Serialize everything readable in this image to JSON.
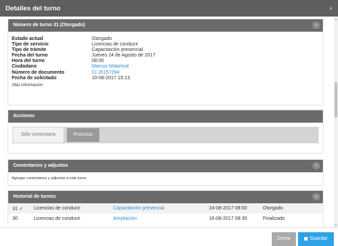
{
  "modal": {
    "title": "Detalles del turno",
    "close_icon": "close-icon"
  },
  "turno_panel": {
    "title": "Número de turno 31 (Otorgado)",
    "fields": [
      {
        "label": "Estado actual",
        "value": "Otorgado",
        "link": false
      },
      {
        "label": "Tipo de servicio",
        "value": "Licencias de conducir",
        "link": false
      },
      {
        "label": "Tipo de trámite",
        "value": "Capacitación presencial",
        "link": false
      },
      {
        "label": "Fecha del turno",
        "value": "Jueves 24 de Agosto de 2017",
        "link": false
      },
      {
        "label": "Hora del turno",
        "value": "08:00",
        "link": false
      },
      {
        "label": "Ciudadano",
        "value": "Marcos Malamud",
        "link": true
      },
      {
        "label": "Número de documento",
        "value": "CI 26157294",
        "link": true
      },
      {
        "label": "Fecha de solicitado",
        "value": "10-08-2017 15:13",
        "link": false
      }
    ],
    "more": "Más información"
  },
  "acciones_panel": {
    "title": "Acciones",
    "tab_label": "Sólo comentario",
    "button_label": "Procesar"
  },
  "comentarios_panel": {
    "title": "Comentarios y adjuntos",
    "text": "Agregar comentarios y adjuntos a este turno"
  },
  "historial_panel": {
    "title": "Historial de turnos",
    "rows": [
      {
        "numero": "31",
        "checked": "✓",
        "servicio": "Licencias de conducir",
        "tramite": "Capacitación presencial",
        "fecha": "24-08-2017 08:00",
        "estado": "Otorgado"
      },
      {
        "numero": "30",
        "checked": "",
        "servicio": "Licencias de conducir",
        "tramite": "Ampliación",
        "fecha": "16-08-2017 08:30",
        "estado": "Finalizado"
      }
    ]
  },
  "footer": {
    "cancel_label": "Cerrar",
    "save_label": "Guardar"
  },
  "colors": {
    "header": "#5f5f5f",
    "panel_header": "#6b6b6b",
    "link": "#2f8fd8",
    "primary": "#2fa3e6"
  }
}
